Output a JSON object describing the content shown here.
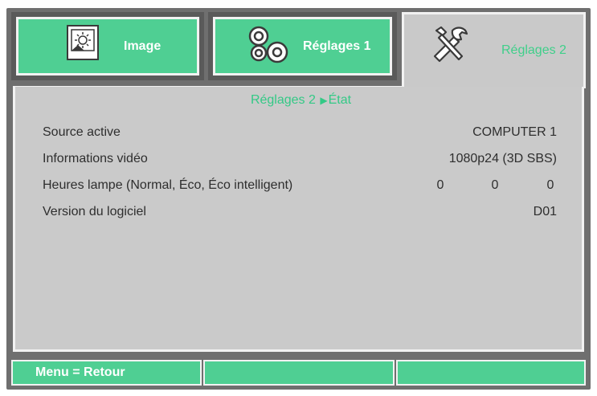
{
  "tabs": [
    {
      "id": "image",
      "label": "Image",
      "icon": "image-icon"
    },
    {
      "id": "reglages1",
      "label": "Réglages 1",
      "icon": "gears-icon"
    },
    {
      "id": "reglages2",
      "label": "Réglages 2",
      "icon": "tools-icon",
      "active": true
    }
  ],
  "breadcrumb": {
    "parent": "Réglages 2",
    "separator": "▶",
    "current": "État"
  },
  "rows": {
    "source": {
      "label": "Source active",
      "value": "COMPUTER 1"
    },
    "video": {
      "label": "Informations vidéo",
      "value": "1080p24 (3D SBS)"
    },
    "lamp": {
      "label": "Heures lampe (Normal, Éco, Éco intelligent)",
      "values": [
        "0",
        "0",
        "0"
      ]
    },
    "software": {
      "label": "Version du logiciel",
      "value": "D01"
    }
  },
  "footer": {
    "hint": "Menu = Retour"
  },
  "colors": {
    "accent": "#4fcf93",
    "accent_text": "#33c986",
    "panel": "#cacaca",
    "frame": "#6f6f6f"
  }
}
